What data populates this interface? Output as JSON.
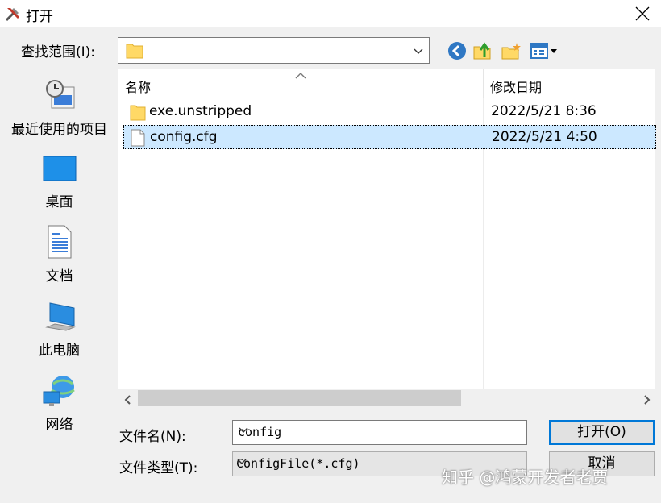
{
  "window": {
    "title": "打开",
    "title_icon": "tools-icon"
  },
  "lookin": {
    "label": "查找范围(I):",
    "value": ""
  },
  "places": [
    {
      "label": "最近使用的项目",
      "icon": "recent-items-icon"
    },
    {
      "label": "桌面",
      "icon": "desktop-icon"
    },
    {
      "label": "文档",
      "icon": "documents-icon"
    },
    {
      "label": "此电脑",
      "icon": "this-pc-icon"
    },
    {
      "label": "网络",
      "icon": "network-icon"
    }
  ],
  "list": {
    "columns": [
      "名称",
      "修改日期"
    ],
    "rows": [
      {
        "name": "exe.unstripped",
        "date": "2022/5/21 8:36",
        "type": "folder"
      },
      {
        "name": "config.cfg",
        "date": "2022/5/21 4:50",
        "type": "file",
        "selected": true
      }
    ]
  },
  "filename": {
    "label": "文件名(N):",
    "value": "config"
  },
  "filetype": {
    "label": "文件类型(T):",
    "value": "ConfigFile(*.cfg)"
  },
  "buttons": {
    "open": "打开(O)",
    "cancel": "取消"
  },
  "watermark": "知乎 @鸿蒙开发者老贾",
  "colors": {
    "selection": "#cce8ff",
    "folder": "#ffd966",
    "accent": "#0078d7"
  }
}
